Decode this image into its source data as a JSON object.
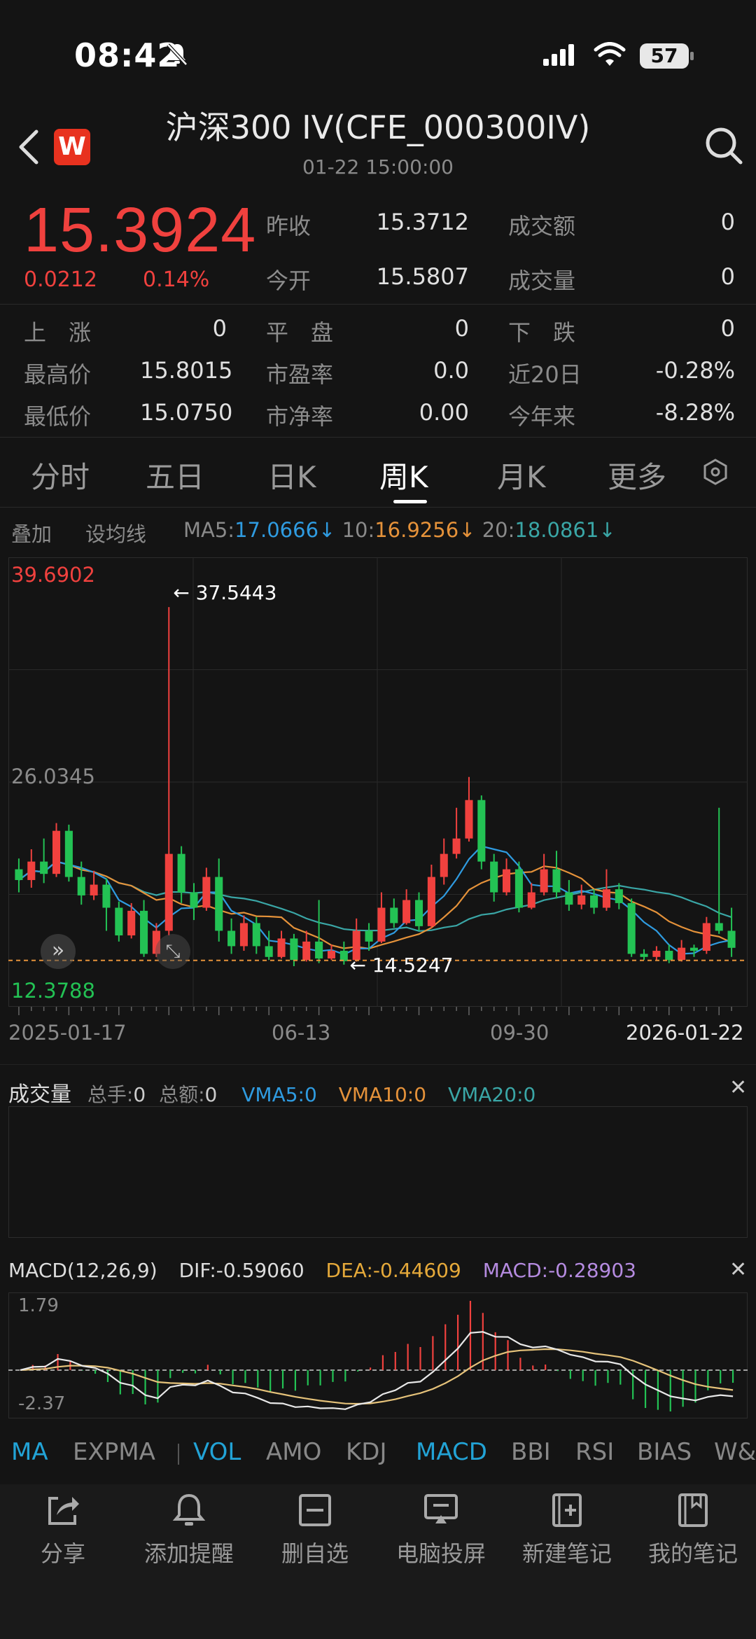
{
  "status": {
    "time": "08:42",
    "battery": "57"
  },
  "header": {
    "title": "沪深300 IV(CFE_000300IV)",
    "subtitle": "01-22 15:00:00",
    "logo": "W"
  },
  "quote": {
    "price": "15.3924",
    "change": "0.0212",
    "change_pct": "0.14%",
    "rows": [
      {
        "l1": "昨收",
        "v1": "15.3712",
        "l2": "成交额",
        "v2": "0"
      },
      {
        "l1": "今开",
        "v1": "15.5807",
        "l2": "成交量",
        "v2": "0"
      }
    ],
    "grid": [
      [
        "上　涨",
        "0",
        "平　盘",
        "0",
        "下　跌",
        "0"
      ],
      [
        "最高价",
        "15.8015",
        "市盈率",
        "0.0",
        "近20日",
        "-0.28%"
      ],
      [
        "最低价",
        "15.0750",
        "市净率",
        "0.00",
        "今年来",
        "-8.28%"
      ]
    ]
  },
  "tabs": [
    "分时",
    "五日",
    "日K",
    "周K",
    "月K",
    "更多"
  ],
  "active_tab": "周K",
  "indicators": {
    "overlay": "叠加",
    "set_ma": "设均线",
    "ma5_label": "MA5:",
    "ma5": "17.0666",
    "arrow": "↓",
    "ma10_label": "10:",
    "ma10": "16.9256",
    "ma20_label": "20:",
    "ma20": "18.0861"
  },
  "colors": {
    "up": "#f0413e",
    "down": "#23c254",
    "ma5": "#2f9be0",
    "ma10": "#e5923a",
    "ma20": "#3aa6a6"
  },
  "chart_data": {
    "type": "candlestick",
    "y_top": "39.6902",
    "y_mid": "26.0345",
    "y_bottom": "12.3788",
    "ylim": [
      12.3788,
      39.6902
    ],
    "max_marker": "37.5443",
    "min_marker": "14.5247",
    "x_labels": [
      "2025-01-17",
      "06-13",
      "09-30",
      "2026-01-22"
    ],
    "last_price": 15.3924,
    "candles": [
      [
        20.5,
        19.8,
        21.2,
        19.0
      ],
      [
        19.8,
        21.0,
        21.8,
        19.3
      ],
      [
        21.0,
        20.2,
        22.5,
        19.6
      ],
      [
        20.2,
        23.0,
        23.5,
        20.0
      ],
      [
        23.0,
        20.0,
        23.4,
        19.7
      ],
      [
        20.0,
        18.8,
        21.0,
        18.2
      ],
      [
        18.8,
        19.5,
        20.4,
        18.5
      ],
      [
        19.5,
        18.0,
        19.9,
        16.5
      ],
      [
        18.0,
        16.2,
        18.4,
        15.8
      ],
      [
        16.2,
        17.8,
        18.3,
        16.0
      ],
      [
        17.8,
        15.0,
        18.5,
        14.8
      ],
      [
        15.0,
        16.5,
        17.0,
        14.8
      ],
      [
        16.5,
        21.5,
        37.5443,
        16.2
      ],
      [
        21.5,
        19.0,
        22.0,
        18.3
      ],
      [
        19.0,
        18.0,
        19.6,
        17.2
      ],
      [
        18.0,
        20.0,
        20.6,
        17.8
      ],
      [
        20.0,
        16.5,
        21.2,
        15.8
      ],
      [
        16.5,
        15.5,
        17.3,
        15.0
      ],
      [
        15.5,
        17.0,
        17.5,
        15.2
      ],
      [
        17.0,
        15.5,
        17.4,
        15.0
      ],
      [
        15.5,
        14.8,
        16.5,
        14.6
      ],
      [
        14.8,
        16.0,
        16.5,
        14.7
      ],
      [
        16.0,
        14.6,
        16.3,
        14.2
      ],
      [
        14.6,
        15.8,
        16.5,
        14.5
      ],
      [
        15.8,
        14.7,
        18.5,
        14.4
      ],
      [
        14.7,
        15.2,
        15.6,
        14.6
      ],
      [
        15.2,
        14.5247,
        15.8,
        14.3
      ],
      [
        14.6,
        16.5,
        17.3,
        14.5
      ],
      [
        16.5,
        15.8,
        17.0,
        15.2
      ],
      [
        15.8,
        18.0,
        19.0,
        15.7
      ],
      [
        18.0,
        17.0,
        18.6,
        16.7
      ],
      [
        17.0,
        18.5,
        19.2,
        16.9
      ],
      [
        18.5,
        16.8,
        19.0,
        16.5
      ],
      [
        16.8,
        20.0,
        20.8,
        16.7
      ],
      [
        20.0,
        21.5,
        22.5,
        19.5
      ],
      [
        21.5,
        22.5,
        24.5,
        21.2
      ],
      [
        22.5,
        25.0,
        26.5,
        22.3
      ],
      [
        25.0,
        21.0,
        25.3,
        20.5
      ],
      [
        21.0,
        19.0,
        21.5,
        18.4
      ],
      [
        19.0,
        20.5,
        21.2,
        18.8
      ],
      [
        20.5,
        18.0,
        21.0,
        17.7
      ],
      [
        18.0,
        19.0,
        19.6,
        17.9
      ],
      [
        19.0,
        20.5,
        21.5,
        18.8
      ],
      [
        20.5,
        19.0,
        21.7,
        18.6
      ],
      [
        19.0,
        18.2,
        19.8,
        17.8
      ],
      [
        18.2,
        18.8,
        19.5,
        17.9
      ],
      [
        18.8,
        18.0,
        19.2,
        17.6
      ],
      [
        18.0,
        19.2,
        20.5,
        17.8
      ],
      [
        19.2,
        18.3,
        19.6,
        17.9
      ],
      [
        18.3,
        15.0,
        18.6,
        14.8
      ],
      [
        15.0,
        14.8,
        15.3,
        14.6
      ],
      [
        14.8,
        15.2,
        15.5,
        14.6
      ],
      [
        15.2,
        14.6,
        15.6,
        14.4
      ],
      [
        14.6,
        15.4,
        15.9,
        14.5
      ],
      [
        15.4,
        15.2,
        15.6,
        14.8
      ],
      [
        15.2,
        17.0,
        17.4,
        15.0
      ],
      [
        17.0,
        16.5,
        24.5,
        16.3
      ],
      [
        16.5,
        15.3924,
        18.0,
        14.8
      ]
    ]
  },
  "volume": {
    "title": "成交量",
    "total_hands_label": "总手:",
    "total_hands": "0",
    "total_amount_label": "总额:",
    "total_amount": "0",
    "vma5_label": "VMA5:",
    "vma5": "0",
    "vma10_label": "VMA10:",
    "vma10": "0",
    "vma20_label": "VMA20:",
    "vma20": "0"
  },
  "macd": {
    "title": "MACD(12,26,9)",
    "dif_label": "DIF:",
    "dif": "-0.59060",
    "dea_label": "DEA:",
    "dea": "-0.44609",
    "macd_label": "MACD:",
    "macd": "-0.28903",
    "y_top": "1.79",
    "y_bottom": "-2.37"
  },
  "indicator_tabs": [
    "MA",
    "EXPMA",
    "VOL",
    "AMO",
    "KDJ",
    "MACD",
    "BBI",
    "RSI",
    "BIAS",
    "W&"
  ],
  "indicator_tabs_selected": [
    "MA",
    "VOL",
    "MACD"
  ],
  "nav": [
    {
      "label": "分享",
      "icon": "share-icon"
    },
    {
      "label": "添加提醒",
      "icon": "bell-icon"
    },
    {
      "label": "删自选",
      "icon": "minus-box-icon"
    },
    {
      "label": "电脑投屏",
      "icon": "cast-icon"
    },
    {
      "label": "新建笔记",
      "icon": "note-add-icon"
    },
    {
      "label": "我的笔记",
      "icon": "notebook-icon"
    }
  ]
}
